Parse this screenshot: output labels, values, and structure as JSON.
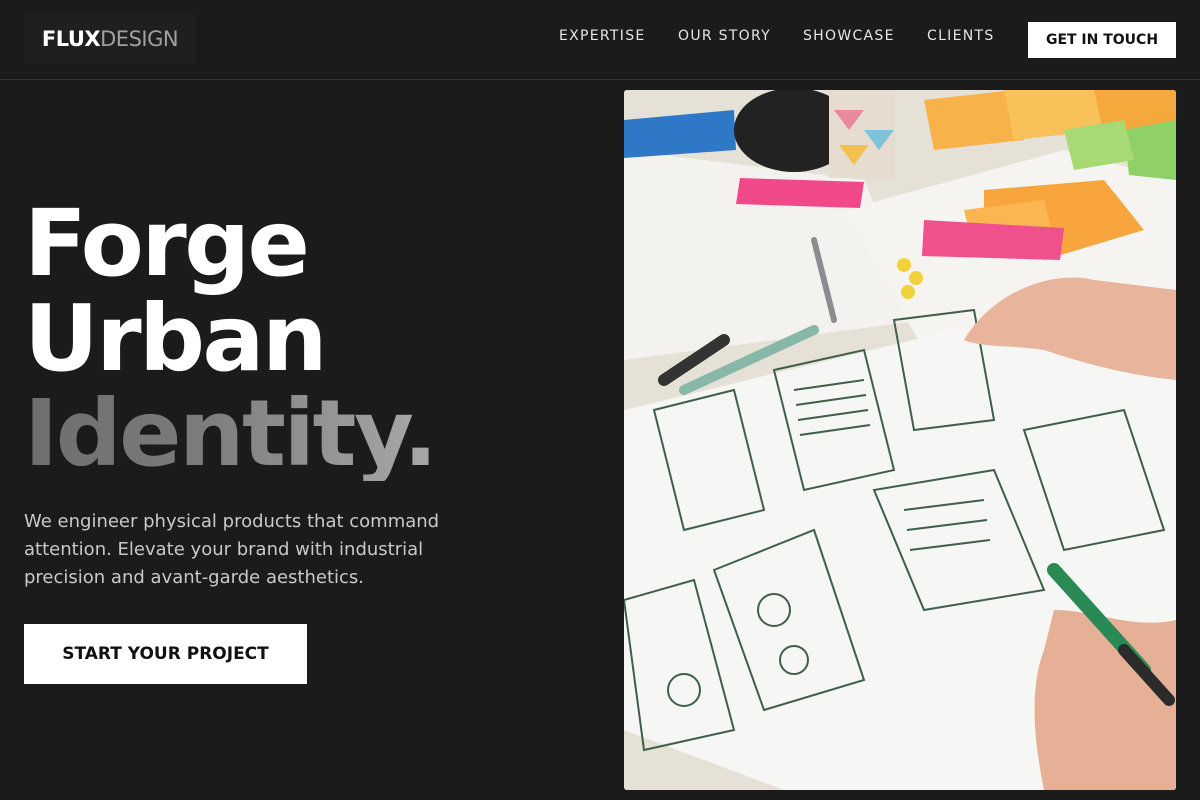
{
  "logo": {
    "bold": "FLUX",
    "light": "DESIGN"
  },
  "nav": {
    "items": [
      {
        "label": "EXPERTISE"
      },
      {
        "label": "OUR STORY"
      },
      {
        "label": "SHOWCASE"
      },
      {
        "label": "CLIENTS"
      }
    ],
    "cta_label": "GET IN TOUCH"
  },
  "hero": {
    "headline": [
      "Forge",
      "Urban",
      "Identity."
    ],
    "subtitle": "We engineer physical products that command attention. Elevate your brand with industrial precision and avant-garde aesthetics.",
    "cta_label": "START YOUR PROJECT",
    "image_icon": "wireframe-sketch-photo"
  },
  "colors": {
    "background": "#1b1b1b",
    "accent": "#ffffff",
    "muted_text": "#c9c9c9"
  }
}
